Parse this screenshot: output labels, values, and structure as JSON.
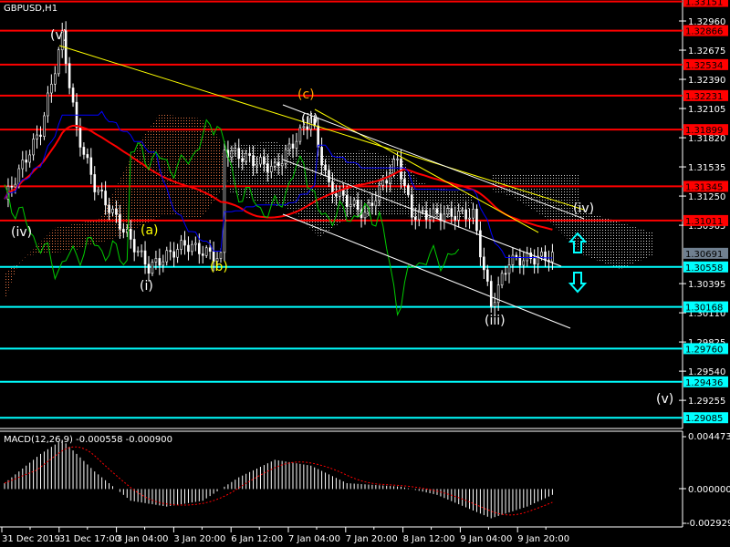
{
  "window": {
    "title": "GBPUSD,H1"
  },
  "price_axis": {
    "ticks": [
      "1.32960",
      "1.32675",
      "1.32390",
      "1.32105",
      "1.31820",
      "1.31535",
      "1.31250",
      "1.30965",
      "1.30395",
      "1.30110",
      "1.29825",
      "1.29540",
      "1.29255"
    ],
    "current_price": "1.30691",
    "resistance_levels": [
      "1.33151",
      "1.32866",
      "1.32534",
      "1.32231",
      "1.31899",
      "1.31345",
      "1.31011"
    ],
    "support_levels": [
      "1.30558",
      "1.30168",
      "1.29760",
      "1.29436",
      "1.29085"
    ]
  },
  "time_axis": {
    "ticks": [
      "31 Dec 2019",
      "31 Dec 17:00",
      "3 Jan 04:00",
      "3 Jan 20:00",
      "6 Jan 12:00",
      "7 Jan 04:00",
      "7 Jan 20:00",
      "8 Jan 12:00",
      "9 Jan 04:00",
      "9 Jan 20:00"
    ]
  },
  "wave_labels": {
    "v_top": "(v)",
    "iv_left": "(iv)",
    "a": "(a)",
    "b": "(b)",
    "i": "(i)",
    "c": "(c)",
    "ii": "(ii)",
    "iii": "(iii)",
    "iv_right": "(iv)",
    "v_target": "(v)"
  },
  "macd": {
    "title": "MACD(12,26,9) -0.000558 -0.000900",
    "ticks": [
      "0.004473",
      "0.000000",
      "-0.002929"
    ]
  },
  "colors": {
    "resistance": "#ff0000",
    "support": "#00ffff",
    "current": "#708090",
    "candle": "#ffffff",
    "ma": "#ff0000",
    "kijun": "#0000ff",
    "chikou": "#00cc00",
    "trend": "#ffff00"
  },
  "chart_data": {
    "type": "candlestick",
    "symbol": "GBPUSD",
    "timeframe": "H1",
    "ylim": [
      1.2898,
      1.33165
    ],
    "price_keypoints": [
      [
        0,
        1.3122
      ],
      [
        10,
        1.3189
      ],
      [
        16,
        1.3281
      ],
      [
        20,
        1.3189
      ],
      [
        25,
        1.3135
      ],
      [
        40,
        1.3055
      ],
      [
        50,
        1.3078
      ],
      [
        60,
        1.3064
      ],
      [
        61,
        1.317
      ],
      [
        75,
        1.3152
      ],
      [
        85,
        1.3201
      ],
      [
        90,
        1.3134
      ],
      [
        100,
        1.3107
      ],
      [
        109,
        1.3161
      ],
      [
        113,
        1.3107
      ],
      [
        130,
        1.3107
      ],
      [
        135,
        1.3018
      ],
      [
        140,
        1.3062
      ],
      [
        152,
        1.3066
      ]
    ],
    "macd_ylim": [
      -0.002929,
      0.004473
    ],
    "macd_keypoints": [
      [
        0,
        0.0005
      ],
      [
        10,
        0.003
      ],
      [
        16,
        0.0042
      ],
      [
        25,
        0.0015
      ],
      [
        35,
        -0.001
      ],
      [
        45,
        -0.0015
      ],
      [
        55,
        -0.001
      ],
      [
        65,
        0.001
      ],
      [
        75,
        0.0025
      ],
      [
        85,
        0.002
      ],
      [
        95,
        0.0005
      ],
      [
        110,
        0.0002
      ],
      [
        120,
        -0.0005
      ],
      [
        135,
        -0.0025
      ],
      [
        145,
        -0.0015
      ],
      [
        152,
        -0.0005
      ]
    ]
  }
}
